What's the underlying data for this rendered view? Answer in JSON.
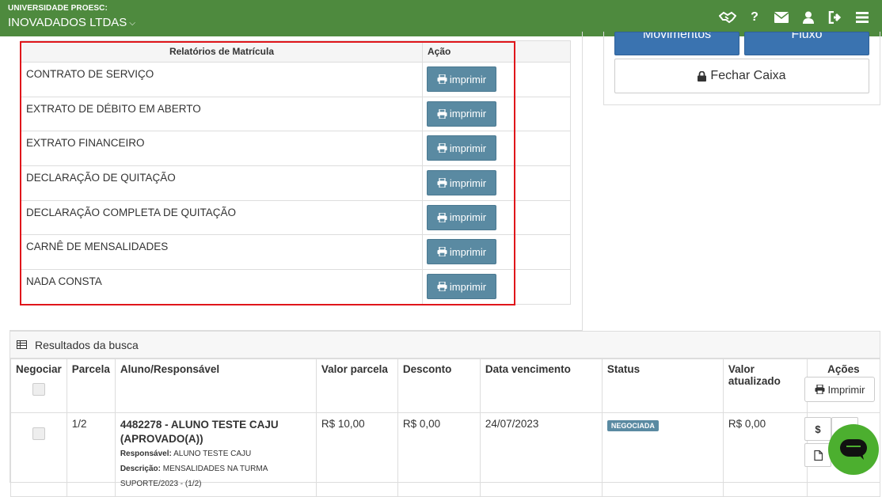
{
  "topbar": {
    "university": "UNIVERSIDADE PROESC:",
    "company": "INOVADADOS LTDAS",
    "icons": [
      "handshake-icon",
      "help-icon",
      "envelope-icon",
      "user-icon",
      "sign-out-icon",
      "menu-icon"
    ]
  },
  "right_panel": {
    "movimentos_label": "Movimentos",
    "fluxo_label": "Fluxo",
    "fechar_caixa_label": "Fechar Caixa"
  },
  "relatorios": {
    "header_name": "Relatórios de Matrícula",
    "header_action": "Ação",
    "print_label": "imprimir",
    "items": [
      {
        "name": "CONTRATO DE SERVIÇO"
      },
      {
        "name": "EXTRATO DE DÉBITO EM ABERTO"
      },
      {
        "name": "EXTRATO FINANCEIRO"
      },
      {
        "name": "DECLARAÇÃO DE QUITAÇÃO"
      },
      {
        "name": "DECLARAÇÃO COMPLETA DE QUITAÇÃO"
      },
      {
        "name": "CARNÊ DE MENSALIDADES"
      },
      {
        "name": "NADA CONSTA"
      }
    ]
  },
  "results": {
    "title": "Resultados da busca",
    "columns": {
      "negociar": "Negociar",
      "parcela": "Parcela",
      "aluno": "Aluno/Responsável",
      "valor_parcela": "Valor parcela",
      "desconto": "Desconto",
      "data_vencimento": "Data vencimento",
      "status": "Status",
      "valor_atualizado": "Valor atualizado",
      "acoes": "Ações"
    },
    "imprimir_label": "Imprimir",
    "row": {
      "parcela": "1/2",
      "aluno_id": "4482278",
      "aluno_name": " - ALUNO TESTE CAJU (APROVADO(A))",
      "responsavel_label": "Responsável:",
      "responsavel": "ALUNO TESTE CAJU",
      "descricao_label": "Descrição:",
      "descricao": "MENSALIDADES NA TURMA",
      "descricao2": "SUPORTE/2023 - (1/2)",
      "valor_parcela": "R$ 10,00",
      "desconto": "R$ 0,00",
      "data_vencimento": "24/07/2023",
      "status": "NEGOCIADA",
      "valor_atualizado": "R$ 0,00",
      "dollar": "$"
    }
  }
}
